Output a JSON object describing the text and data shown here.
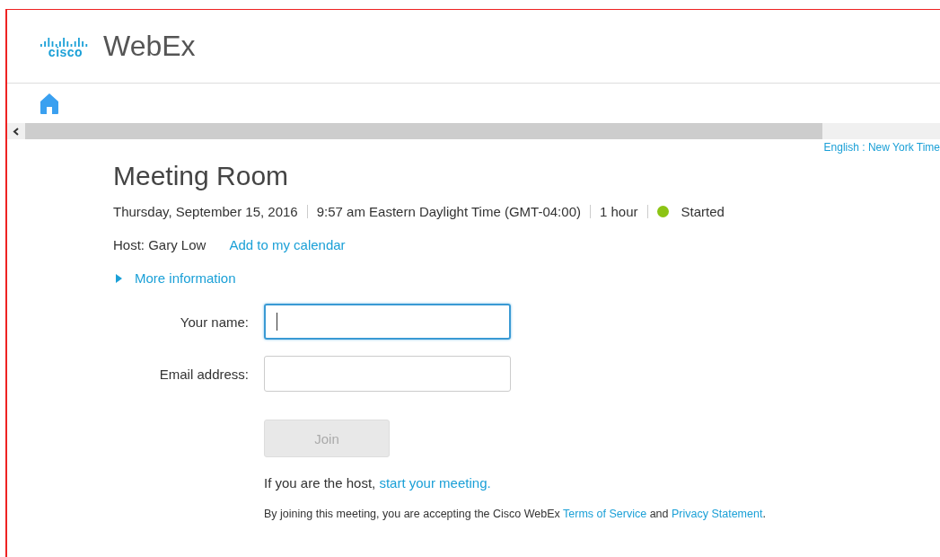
{
  "header": {
    "logo_mark": "cisco",
    "product": "WebEx"
  },
  "locale_link": "English : New York Time",
  "meeting": {
    "title": "Meeting Room",
    "details": [
      {
        "kind": "text",
        "text": "Thursday, September 15, 2016"
      },
      {
        "kind": "text",
        "text": "9:57 am Eastern Daylight Time (GMT-04:00)"
      },
      {
        "kind": "text",
        "text": "1 hour"
      },
      {
        "kind": "status",
        "text": "Started",
        "color": "#8cc414"
      }
    ],
    "host": "Host: Gary Low",
    "calendar_link": "Add to my calendar",
    "more_info": {
      "label": "More information",
      "expanded": false
    }
  },
  "form": {
    "fields": [
      {
        "label": "Your name:",
        "focused": true
      },
      {
        "label": "Email address:",
        "focused": false
      }
    ],
    "join_button": {
      "label": "Join",
      "disabled": true
    }
  },
  "host_note": [
    {
      "kind": "text",
      "text": "If you are the host, "
    },
    {
      "kind": "link",
      "text": "start your meeting."
    }
  ],
  "terms": [
    {
      "kind": "text",
      "text": "By joining this meeting, you are accepting the Cisco WebEx "
    },
    {
      "kind": "link",
      "text": "Terms of Service"
    },
    {
      "kind": "text",
      "text": " and "
    },
    {
      "kind": "link",
      "text": "Privacy Statement"
    },
    {
      "kind": "text",
      "text": "."
    }
  ]
}
